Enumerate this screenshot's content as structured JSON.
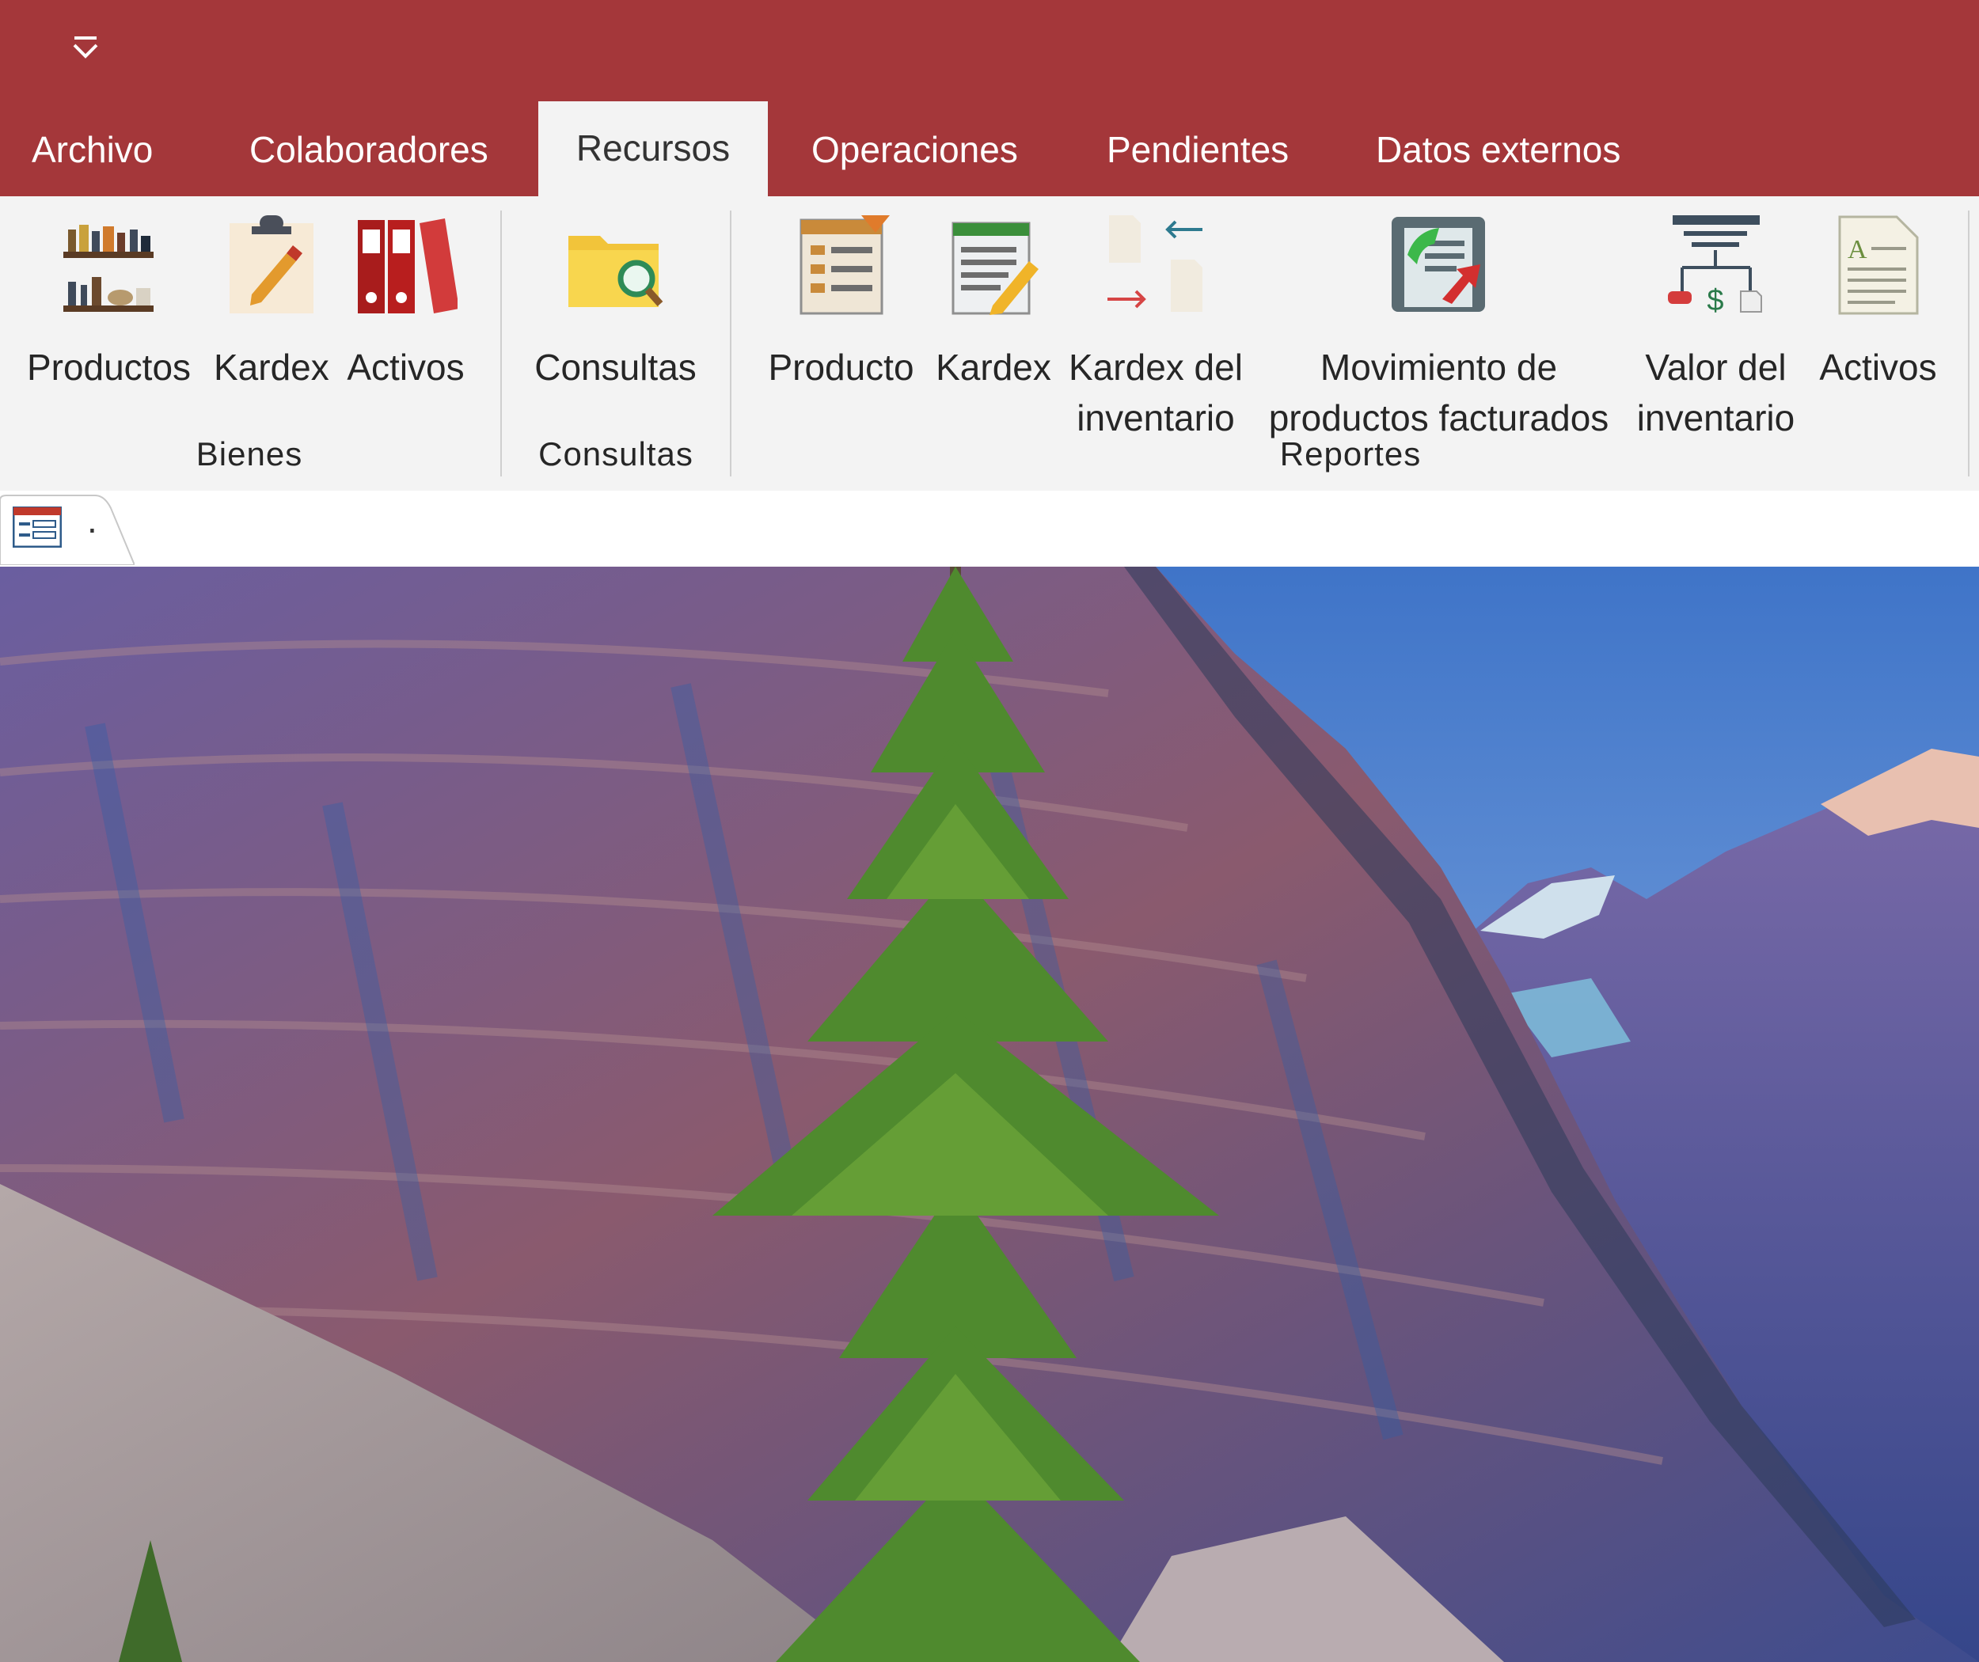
{
  "ribbon_tabs": [
    {
      "label": "Archivo",
      "active": false
    },
    {
      "label": "Colaboradores",
      "active": false
    },
    {
      "label": "Recursos",
      "active": true
    },
    {
      "label": "Operaciones",
      "active": false
    },
    {
      "label": "Pendientes",
      "active": false
    },
    {
      "label": "Datos externos",
      "active": false
    }
  ],
  "groups": {
    "bienes": {
      "title": "Bienes",
      "buttons": [
        {
          "label": "Productos",
          "icon": "shelves-icon"
        },
        {
          "label": "Kardex",
          "icon": "clipboard-pencil-icon"
        },
        {
          "label": "Activos",
          "icon": "binders-icon"
        }
      ]
    },
    "consultas": {
      "title": "Consultas",
      "buttons": [
        {
          "label": "Consultas",
          "icon": "folder-search-icon"
        }
      ]
    },
    "reportes": {
      "title": "Reportes",
      "buttons": [
        {
          "label": "Producto",
          "icon": "report-list-icon"
        },
        {
          "label": "Kardex",
          "icon": "document-pencil-icon"
        },
        {
          "label_line1": "Kardex del",
          "label_line2": "inventario",
          "icon": "document-exchange-icon"
        },
        {
          "label_line1": "Movimiento de",
          "label_line2": "productos facturados",
          "icon": "chart-document-icon"
        },
        {
          "label_line1": "Valor del",
          "label_line2": "inventario",
          "icon": "diagram-dollar-icon"
        },
        {
          "label": "Activos",
          "icon": "text-document-icon"
        }
      ]
    }
  },
  "document_tab": {
    "label": ".",
    "icon": "form-icon"
  },
  "colors": {
    "title_bar": "#a4373a",
    "ribbon_bg": "#f3f3f3",
    "text": "#262626"
  }
}
